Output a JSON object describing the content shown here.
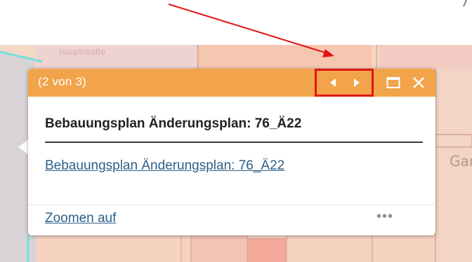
{
  "popup": {
    "counter": "(2 von 3)",
    "title": "Bebauungsplan Änderungsplan: 76_Ä22",
    "link": "Bebauungsplan Änderungsplan: 76_Ä22",
    "zoom_label": "Zoomen auf",
    "more_label": "•••",
    "header_color": "#f2a44a",
    "link_color": "#2e5f88"
  },
  "map": {
    "street_label": "Garte",
    "faded_label": "Hauptstraße"
  },
  "annotation": {
    "arrow_color": "#e31414",
    "highlight_color": "#e31414"
  },
  "icons": {
    "prev": "caret-left-icon",
    "next": "caret-right-icon",
    "maximize": "maximize-icon",
    "close": "close-icon",
    "more": "more-icon"
  }
}
